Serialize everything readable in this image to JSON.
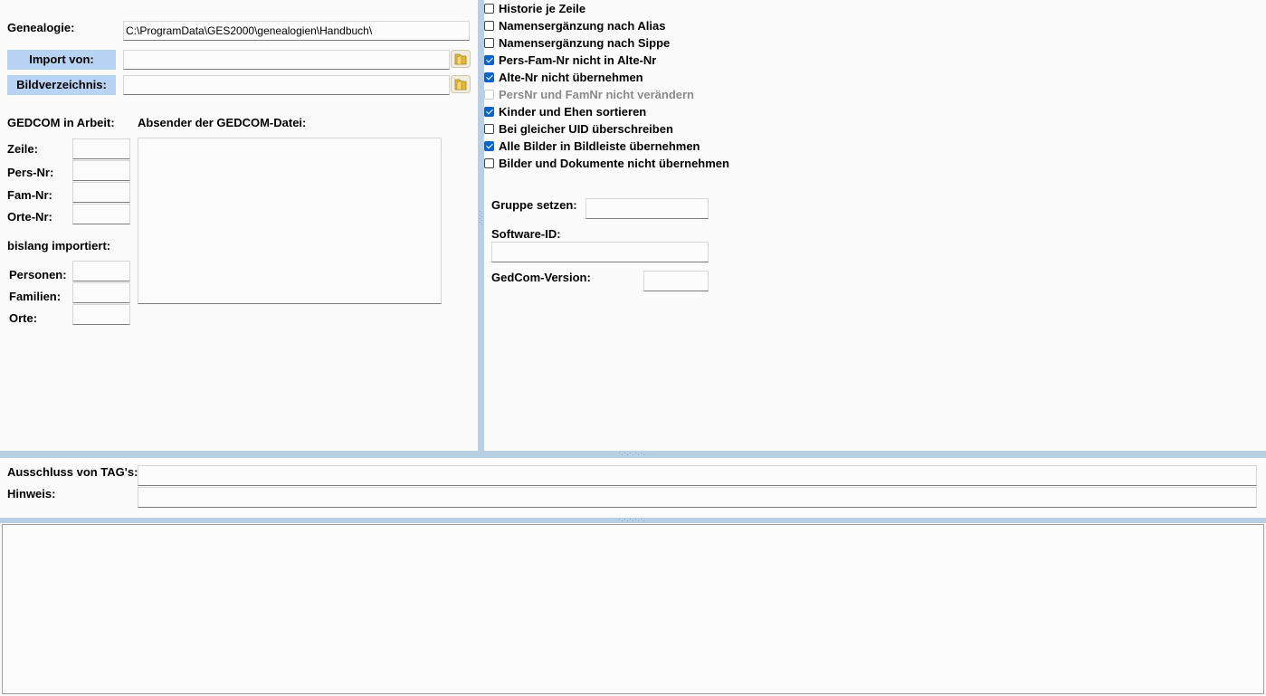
{
  "left": {
    "genealogie_label": "Genealogie:",
    "genealogie_path": "C:\\ProgramData\\GES2000\\genealogien\\Handbuch\\",
    "import_label": "Import von:",
    "import_value": "",
    "bildverzeichnis_label": "Bildverzeichnis:",
    "bildverzeichnis_value": "",
    "gedcom_in_arbeit": "GEDCOM in Arbeit:",
    "absender_label": "Absender der GEDCOM-Datei:",
    "absender_value": "",
    "zeile_label": "Zeile:",
    "zeile_value": "",
    "persnr_label": "Pers-Nr:",
    "persnr_value": "",
    "famnr_label": "Fam-Nr:",
    "famnr_value": "",
    "ortenr_label": "Orte-Nr:",
    "ortenr_value": "",
    "bislang_label": "bislang importiert:",
    "personen_label": "Personen:",
    "personen_value": "",
    "familien_label": "Familien:",
    "familien_value": "",
    "orte_label": "Orte:",
    "orte_value": ""
  },
  "options": [
    {
      "label": "Historie je Zeile",
      "checked": false,
      "disabled": false
    },
    {
      "label": "Namensergänzung nach Alias",
      "checked": false,
      "disabled": false
    },
    {
      "label": "Namensergänzung nach Sippe",
      "checked": false,
      "disabled": false
    },
    {
      "label": "Pers-Fam-Nr nicht in Alte-Nr",
      "checked": true,
      "disabled": false
    },
    {
      "label": "Alte-Nr nicht übernehmen",
      "checked": true,
      "disabled": false
    },
    {
      "label": "PersNr und FamNr nicht verändern",
      "checked": false,
      "disabled": true
    },
    {
      "label": "Kinder und Ehen sortieren",
      "checked": true,
      "disabled": false
    },
    {
      "label": "Bei gleicher UID überschreiben",
      "checked": false,
      "disabled": false
    },
    {
      "label": "Alle Bilder in Bildleiste übernehmen",
      "checked": true,
      "disabled": false
    },
    {
      "label": "Bilder und Dokumente nicht übernehmen",
      "checked": false,
      "disabled": false
    }
  ],
  "right": {
    "gruppe_label": "Gruppe setzen:",
    "gruppe_value": "",
    "software_label": "Software-ID:",
    "software_value": "",
    "gedcom_version_label": "GedCom-Version:",
    "gedcom_version_value": ""
  },
  "middle": {
    "ausschluss_label": "Ausschluss von TAG's:",
    "ausschluss_value": "",
    "hinweis_label": "Hinweis:",
    "hinweis_value": ""
  },
  "log": {
    "text": ""
  },
  "colors": {
    "accent": "#b9d3f5",
    "separator": "#b9cfe3",
    "checkbox": "#0b64c8"
  }
}
